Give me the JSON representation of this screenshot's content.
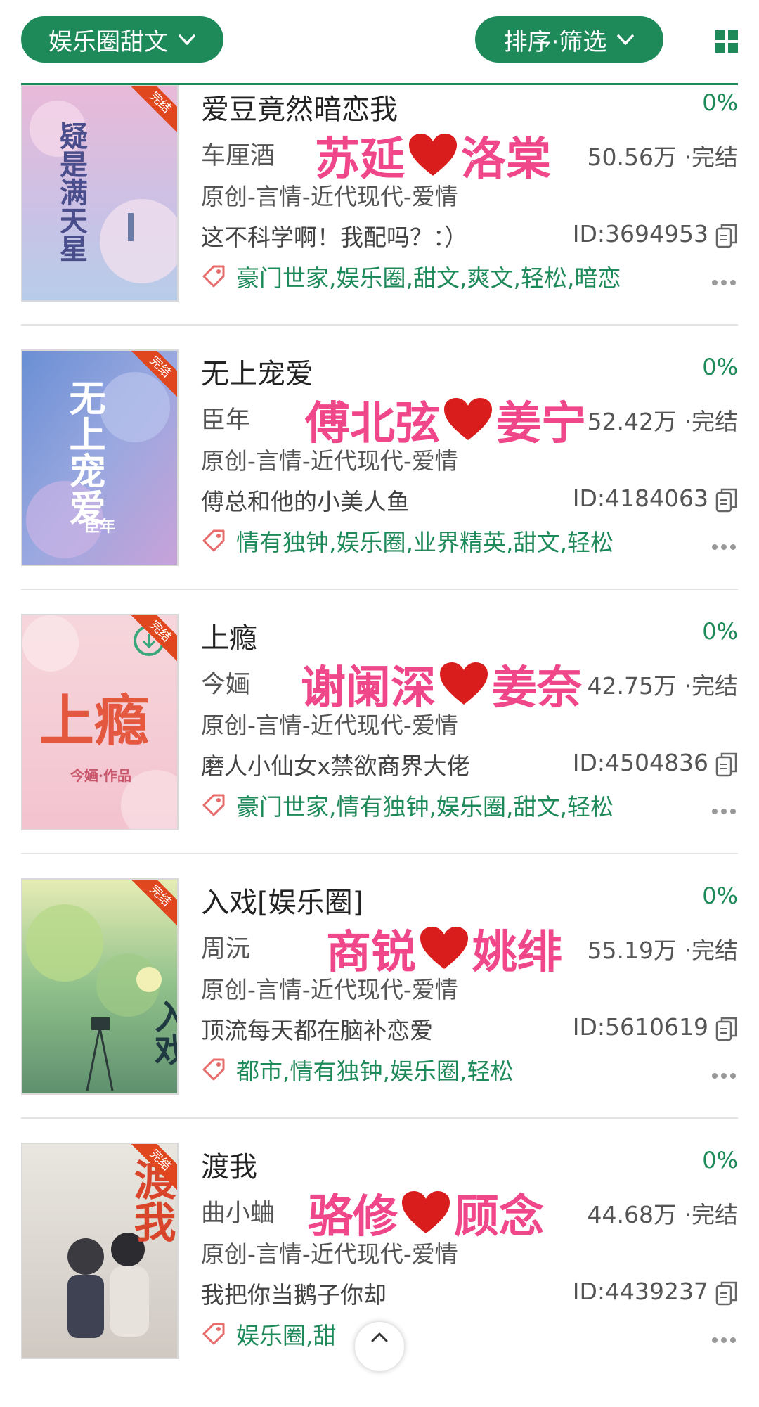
{
  "header": {
    "category_label": "娱乐圈甜文",
    "sort_filter_label": "排序·筛选"
  },
  "colors": {
    "accent": "#1e8a5a",
    "overlay_pink": "#f0478a",
    "heart_red": "#d91c1c",
    "ribbon": "#e0471e"
  },
  "books": [
    {
      "title": "爱豆竟然暗恋我",
      "progress": "0%",
      "author": "车厘酒",
      "stats": "50.56万 ·完结",
      "genre": "原创-言情-近代现代-爱情",
      "summary": "这不科学啊！我配吗？：）",
      "id": "ID:3694953",
      "tags": "豪门世家,娱乐圈,甜文,爽文,轻松,暗恋",
      "couple_left": "苏延",
      "couple_right": "洛棠",
      "cover_badge": "完结",
      "cover_title": "疑是满天星"
    },
    {
      "title": "无上宠爱",
      "progress": "0%",
      "author": "臣年",
      "stats": "52.42万 ·完结",
      "genre": "原创-言情-近代现代-爱情",
      "summary": "傅总和他的小美人鱼",
      "id": "ID:4184063",
      "tags": "情有独钟,娱乐圈,业界精英,甜文,轻松",
      "couple_left": "傅北弦",
      "couple_right": "姜宁",
      "cover_badge": "完结",
      "cover_title": "无上宠爱",
      "cover_subtitle": "臣年"
    },
    {
      "title": "上瘾",
      "progress": "0%",
      "author": "今婳",
      "stats": "42.75万 ·完结",
      "genre": "原创-言情-近代现代-爱情",
      "summary": "磨人小仙女x禁欲商界大佬",
      "id": "ID:4504836",
      "tags": "豪门世家,情有独钟,娱乐圈,甜文,轻松",
      "couple_left": "谢阑深",
      "couple_right": "姜奈",
      "cover_badge": "完结",
      "cover_title": "上瘾",
      "cover_subtitle": "今婳·作品"
    },
    {
      "title": "入戏[娱乐圈]",
      "progress": "0%",
      "author": "周沅",
      "stats": "55.19万 ·完结",
      "genre": "原创-言情-近代现代-爱情",
      "summary": "顶流每天都在脑补恋爱",
      "id": "ID:5610619",
      "tags": "都市,情有独钟,娱乐圈,轻松",
      "couple_left": "商锐",
      "couple_right": "姚绯",
      "cover_badge": "完结",
      "cover_title": "入戏"
    },
    {
      "title": "渡我",
      "progress": "0%",
      "author": "曲小蛐",
      "stats": "44.68万 ·完结",
      "genre": "原创-言情-近代现代-爱情",
      "summary": "我把你当鹅子你却",
      "id": "ID:4439237",
      "tags": "娱乐圈,甜",
      "couple_left": "骆修",
      "couple_right": "顾念",
      "cover_badge": "完结",
      "cover_title": "渡我"
    }
  ]
}
